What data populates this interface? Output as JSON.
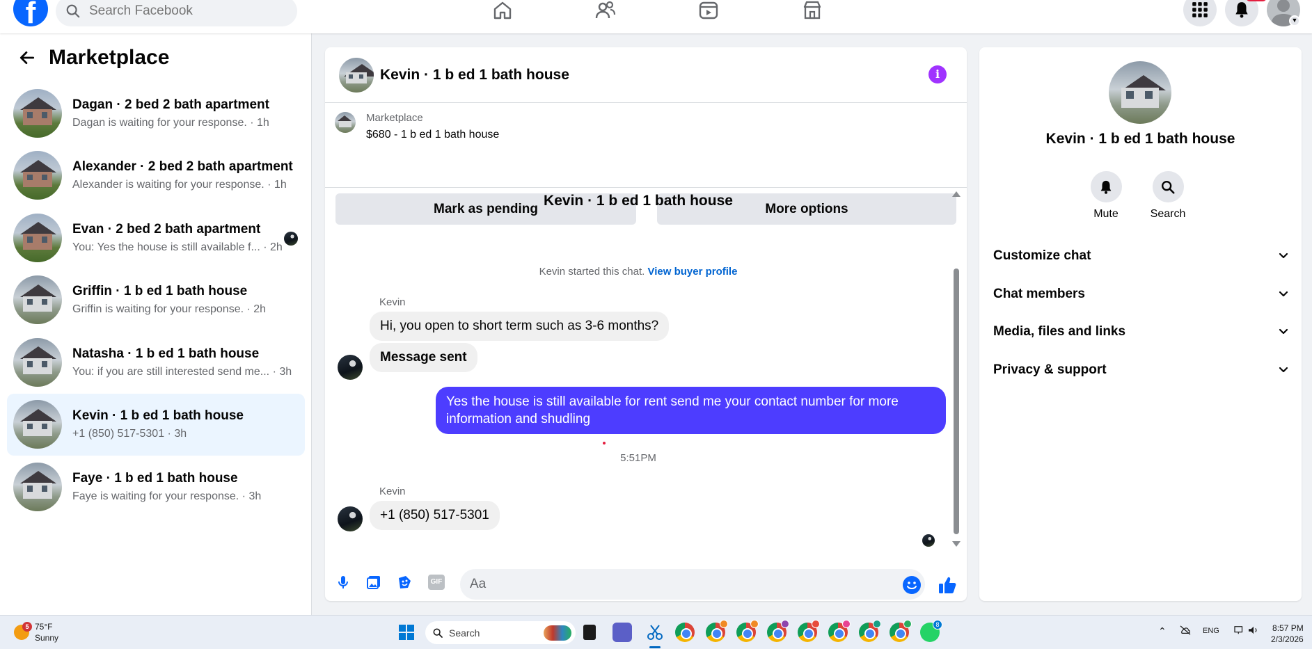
{
  "topbar": {
    "logo": "f",
    "search_placeholder": "Search Facebook",
    "nav_icons": [
      "home-icon",
      "friends-icon",
      "video-icon",
      "marketplace-icon"
    ],
    "right_icons": [
      "menu-grid-icon",
      "bell-icon",
      "profile-avatar"
    ]
  },
  "sidebar": {
    "title": "Marketplace",
    "conversations": [
      {
        "name": "Dagan · 2 bed 2 bath apartment",
        "sub": "Dagan is waiting for your response. · 1h"
      },
      {
        "name": "Alexander · 2 bed 2 bath apartment",
        "sub": "Alexander is waiting for your response. · 1h"
      },
      {
        "name": "Evan · 2 bed 2 bath apartment",
        "sub": "You: Yes the house is still available f... · 2h"
      },
      {
        "name": "Griffin · 1 b ed 1 bath house",
        "sub": "Griffin is waiting for your response. · 2h"
      },
      {
        "name": "Natasha · 1 b ed 1 bath house",
        "sub": "You: if you are still interested send me... · 3h"
      },
      {
        "name": "Kevin · 1 b ed 1 bath house",
        "sub": "+1 (850) 517-5301 · 3h"
      },
      {
        "name": "Faye · 1 b ed 1 bath house",
        "sub": "Faye is waiting for your response. · 3h"
      }
    ]
  },
  "chat": {
    "header_title": "Kevin · 1 b ed 1 bath house",
    "listing": {
      "label": "Marketplace",
      "price_title": "$680 - 1 b ed 1 bath house",
      "mark_pending": "Mark as pending",
      "more_options": "More options"
    },
    "thread_title": "Kevin · 1 b ed 1 bath house",
    "started_text": "Kevin started this chat.",
    "view_buyer_profile": "View buyer profile",
    "sender_1": "Kevin",
    "msg_in_1": "Hi, you open to short term such as 3-6 months?",
    "msg_in_2": "Message sent",
    "msg_out_1": "Yes the house is still available for rent send me your contact number for more information and shudling",
    "timestamp": "5:51PM",
    "sender_2": "Kevin",
    "msg_in_3": "+1 (850) 517-5301",
    "composer_placeholder": "Aa",
    "gif_label": "GIF"
  },
  "info_panel": {
    "title": "Kevin · 1 b ed 1 bath house",
    "mute_label": "Mute",
    "search_label": "Search",
    "sections": [
      "Customize chat",
      "Chat members",
      "Media, files and links",
      "Privacy & support"
    ]
  },
  "taskbar": {
    "weather_badge": "5",
    "temperature": "75°F",
    "condition": "Sunny",
    "search_label": "Search",
    "language": "ENG",
    "time": "8:57 PM",
    "date": "2/3/2026",
    "whatsapp_badge": "8"
  },
  "colors": {
    "facebook_blue": "#0866ff",
    "outgoing_bubble": "#4d3dff",
    "active_conversation": "#ebf5ff",
    "info_icon": "#a033ff"
  }
}
